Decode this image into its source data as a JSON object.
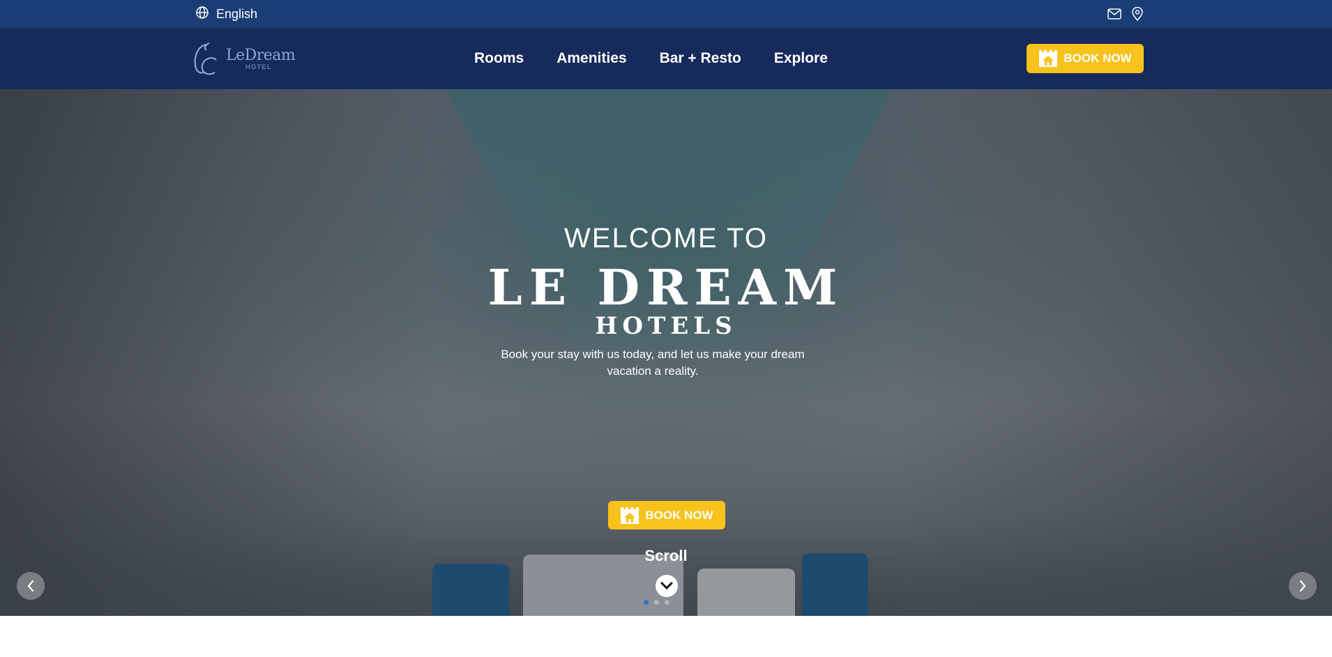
{
  "topbar": {
    "language_label": "English",
    "icons": [
      "globe-icon",
      "mail-icon",
      "map-pin-icon"
    ]
  },
  "header": {
    "logo_monogram": "LC",
    "logo_name": "LeDream",
    "logo_sub": "HOTEL",
    "nav": [
      {
        "label": "Rooms"
      },
      {
        "label": "Amenities"
      },
      {
        "label": "Bar + Resto"
      },
      {
        "label": "Explore"
      }
    ],
    "book_label": "BOOK NOW"
  },
  "hero": {
    "welcome": "WELCOME TO",
    "brand": "LE DREAM",
    "brand_sub": "HOTELS",
    "tagline": "Book your stay with us today, and let us make your dream vacation a reality.",
    "book_label": "BOOK NOW",
    "scroll_label": "Scroll",
    "slides_count": 3,
    "active_slide": 1
  },
  "colors": {
    "topbar": "#1a3d75",
    "header": "#172a5c",
    "accent": "#f6c21b",
    "dot_active": "#2e74c9"
  }
}
